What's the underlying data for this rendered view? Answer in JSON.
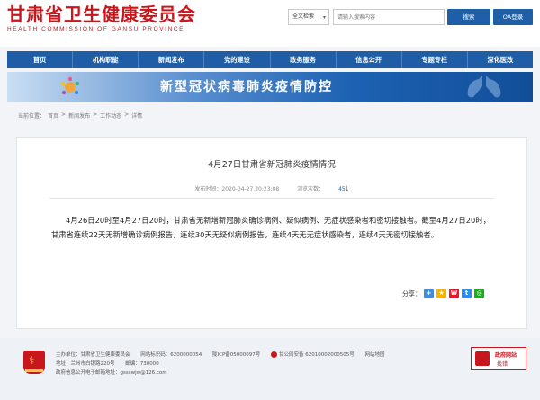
{
  "header": {
    "title": "甘肃省卫生健康委员会",
    "subtitle": "HEALTH COMMISSION OF GANSU PROVINCE",
    "search_scope": "全文检索",
    "search_placeholder": "请输入搜索内容",
    "search_button": "搜索",
    "oa_button": "OA登录"
  },
  "nav": {
    "items": [
      "首页",
      "机构职能",
      "新闻发布",
      "党的建设",
      "政务服务",
      "信息公开",
      "专题专栏",
      "深化医改"
    ]
  },
  "banner": {
    "title": "新型冠状病毒肺炎疫情防控"
  },
  "breadcrumb": {
    "label": "当前位置：",
    "items": [
      "首页",
      "新闻发布",
      "工作动态",
      "详情"
    ],
    "separator": ">"
  },
  "article": {
    "title": "4月27日甘肃省新冠肺炎疫情情况",
    "published_label": "发布时间：",
    "published": "2020-04-27 20:23:08",
    "views_label": "浏览次数：",
    "views": "451",
    "body": "4月26日20时至4月27日20时，甘肃省无新增新冠肺炎确诊病例、疑似病例、无症状感染者和密切接触者。截至4月27日20时，甘肃省连续22天无新增确诊病例报告，连续30天无疑似病例报告，连续4天无无症状感染者，连续4天无密切接触者。",
    "share_label": "分享："
  },
  "footer": {
    "sponsor": "主办单位：甘肃省卫生健康委员会",
    "site_id": "网站标识码：6200000054",
    "icp": "陇ICP备05000097号",
    "police": "甘公网安备 62010002000505号",
    "sitemap": "网站地图",
    "address": "地址：兰州市白银路220号",
    "postcode": "邮编：730000",
    "email": "政府信息公开电子邮箱地址：gssswjw@126.com",
    "gov_badge_title": "政府网站",
    "gov_badge_sub": "找错"
  },
  "colors": {
    "brand_red": "#c8161d",
    "nav_blue": "#1f5ea6"
  }
}
